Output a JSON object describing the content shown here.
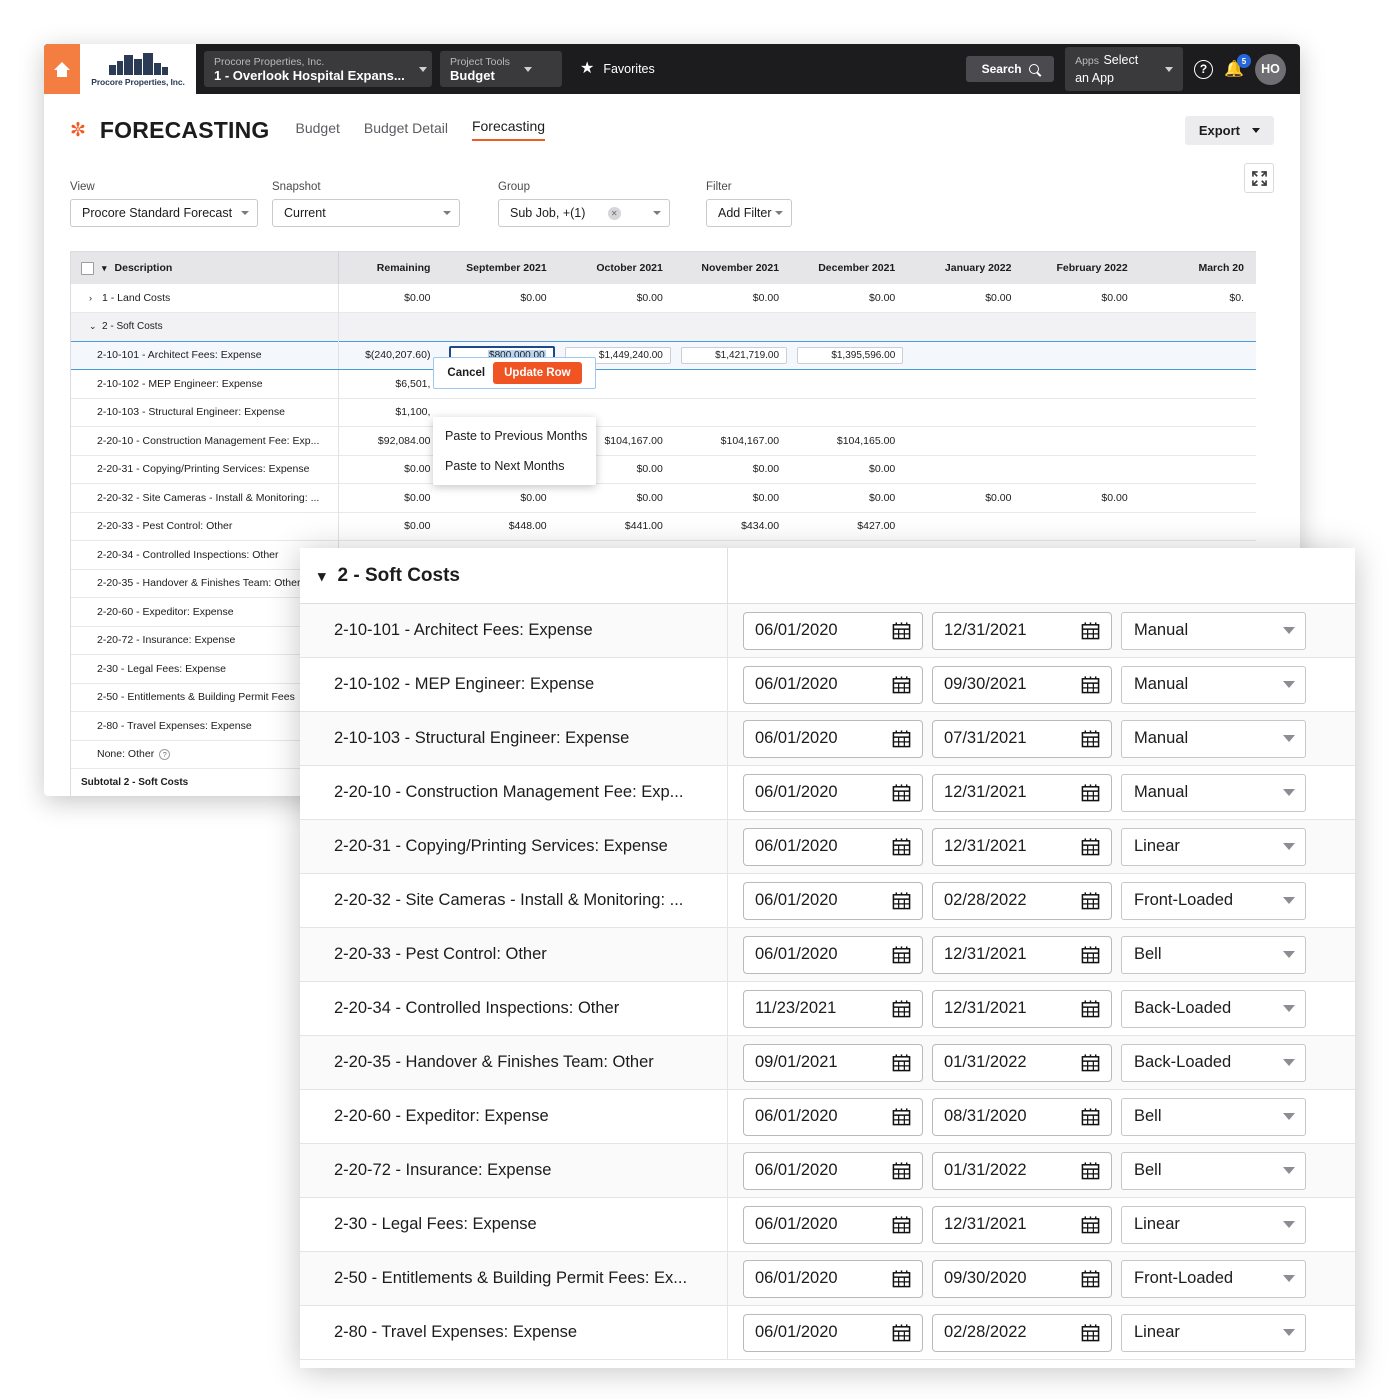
{
  "topnav": {
    "home_icon": "home-icon",
    "logo_name": "Procore Properties, Inc.",
    "company_select": {
      "label": "Procore Properties, Inc.",
      "value": "1 - Overlook Hospital Expans..."
    },
    "tools_select": {
      "label": "Project Tools",
      "value": "Budget"
    },
    "favorites": "Favorites",
    "search": "Search",
    "apps_select": {
      "label": "Apps",
      "value": "Select an App"
    },
    "help_icon": "?",
    "notification_count": "5",
    "avatar_initials": "HO"
  },
  "page": {
    "title": "FORECASTING",
    "tabs": [
      {
        "label": "Budget",
        "active": false
      },
      {
        "label": "Budget Detail",
        "active": false
      },
      {
        "label": "Forecasting",
        "active": true
      }
    ],
    "export_label": "Export"
  },
  "filters": [
    {
      "name": "view",
      "label": "View",
      "value": "Procore Standard Forecast"
    },
    {
      "name": "snapshot",
      "label": "Snapshot",
      "value": "Current"
    },
    {
      "name": "group",
      "label": "Group",
      "value": "Sub Job, +(1)"
    },
    {
      "name": "filter",
      "label": "Filter",
      "value": "Add Filter"
    }
  ],
  "table": {
    "columns": [
      "Description",
      "Remaining",
      "September 2021",
      "October 2021",
      "November 2021",
      "December 2021",
      "January 2022",
      "February 2022",
      "March 20"
    ],
    "rows": [
      {
        "kind": "group",
        "twisty": "›",
        "desc": "1 - Land Costs",
        "vals": [
          "$0.00",
          "$0.00",
          "$0.00",
          "$0.00",
          "$0.00",
          "$0.00",
          "$0.00",
          "$0."
        ]
      },
      {
        "kind": "group",
        "twisty": "⌄",
        "desc": "2 - Soft Costs",
        "vals": [
          "",
          "",
          "",
          "",
          "",
          "",
          "",
          ""
        ]
      },
      {
        "kind": "selected",
        "desc": "2-10-101 - Architect Fees: Expense",
        "remaining": "$(240,207.60)",
        "editable": [
          "$800,000.00",
          "$1,449,240.00",
          "$1,421,719.00",
          "$1,395,596.00"
        ],
        "vals": [
          "",
          "",
          "",
          ""
        ]
      },
      {
        "kind": "item",
        "desc": "2-10-102 - MEP Engineer: Expense",
        "vals": [
          "$6,501,",
          "",
          "",
          "",
          "",
          "",
          "",
          ""
        ]
      },
      {
        "kind": "item",
        "desc": "2-10-103 - Structural Engineer: Expense",
        "vals": [
          "$1,100,",
          "",
          "",
          "",
          "",
          "",
          "",
          ""
        ]
      },
      {
        "kind": "item",
        "desc": "2-20-10 - Construction Management Fee: Exp...",
        "vals": [
          "$92,084.00",
          "$104,167.00",
          "$104,167.00",
          "$104,167.00",
          "$104,165.00",
          "",
          "",
          ""
        ]
      },
      {
        "kind": "item",
        "desc": "2-20-31 - Copying/Printing Services: Expense",
        "vals": [
          "$0.00",
          "$0.00",
          "$0.00",
          "$0.00",
          "$0.00",
          "",
          "",
          ""
        ]
      },
      {
        "kind": "item",
        "desc": "2-20-32 - Site Cameras - Install & Monitoring: ...",
        "vals": [
          "$0.00",
          "$0.00",
          "$0.00",
          "$0.00",
          "$0.00",
          "$0.00",
          "$0.00",
          ""
        ]
      },
      {
        "kind": "item",
        "desc": "2-20-33 - Pest Control: Other",
        "vals": [
          "$0.00",
          "$448.00",
          "$441.00",
          "$434.00",
          "$427.00",
          "",
          "",
          ""
        ]
      },
      {
        "kind": "item",
        "desc": "2-20-34 - Controlled Inspections: Other",
        "vals": [
          "",
          "",
          "",
          "",
          "",
          "",
          "",
          ""
        ]
      },
      {
        "kind": "item",
        "desc": "2-20-35 - Handover & Finishes Team: Other",
        "vals": [
          "",
          "",
          "",
          "",
          "",
          "",
          "",
          ""
        ]
      },
      {
        "kind": "item",
        "desc": "2-20-60 - Expeditor: Expense",
        "vals": [
          "",
          "",
          "",
          "",
          "",
          "",
          "",
          ""
        ]
      },
      {
        "kind": "item",
        "desc": "2-20-72 - Insurance: Expense",
        "vals": [
          "",
          "",
          "",
          "",
          "",
          "",
          "",
          ""
        ]
      },
      {
        "kind": "item",
        "desc": "2-30 - Legal Fees: Expense",
        "vals": [
          "",
          "",
          "",
          "",
          "",
          "",
          "",
          ""
        ]
      },
      {
        "kind": "item",
        "desc": "2-50 - Entitlements & Building Permit Fees",
        "vals": [
          "",
          "",
          "",
          "",
          "",
          "",
          "",
          ""
        ]
      },
      {
        "kind": "item",
        "desc": "2-80 - Travel Expenses: Expense",
        "vals": [
          "",
          "",
          "",
          "",
          "",
          "",
          "",
          ""
        ]
      },
      {
        "kind": "item",
        "desc": "None: Other",
        "help": true,
        "vals": [
          "",
          "",
          "",
          "",
          "",
          "",
          "",
          ""
        ]
      },
      {
        "kind": "subtotal",
        "desc": "Subtotal 2 - Soft Costs",
        "vals": [
          "",
          "",
          "",
          "",
          "",
          "",
          "",
          ""
        ]
      }
    ]
  },
  "update_popover": {
    "cancel": "Cancel",
    "update": "Update Row"
  },
  "context_menu": {
    "items": [
      "Paste to Previous Months",
      "Paste to Next Months"
    ]
  },
  "collapse_icon": "«",
  "forecast_panel": {
    "group_title": "2 - Soft Costs",
    "rows": [
      {
        "name": "2-10-101 - Architect Fees: Expense",
        "start": "06/01/2020",
        "end": "12/31/2021",
        "curve": "Manual"
      },
      {
        "name": "2-10-102 - MEP Engineer: Expense",
        "start": "06/01/2020",
        "end": "09/30/2021",
        "curve": "Manual"
      },
      {
        "name": "2-10-103 - Structural Engineer: Expense",
        "start": "06/01/2020",
        "end": "07/31/2021",
        "curve": "Manual"
      },
      {
        "name": "2-20-10 - Construction Management Fee: Exp...",
        "start": "06/01/2020",
        "end": "12/31/2021",
        "curve": "Manual"
      },
      {
        "name": "2-20-31 - Copying/Printing Services: Expense",
        "start": "06/01/2020",
        "end": "12/31/2021",
        "curve": "Linear"
      },
      {
        "name": "2-20-32 - Site Cameras - Install & Monitoring: ...",
        "start": "06/01/2020",
        "end": "02/28/2022",
        "curve": "Front-Loaded"
      },
      {
        "name": "2-20-33 - Pest Control: Other",
        "start": "06/01/2020",
        "end": "12/31/2021",
        "curve": "Bell"
      },
      {
        "name": "2-20-34 - Controlled Inspections: Other",
        "start": "11/23/2021",
        "end": "12/31/2021",
        "curve": "Back-Loaded"
      },
      {
        "name": "2-20-35 - Handover & Finishes Team: Other",
        "start": "09/01/2021",
        "end": "01/31/2022",
        "curve": "Back-Loaded"
      },
      {
        "name": "2-20-60 - Expeditor: Expense",
        "start": "06/01/2020",
        "end": "08/31/2020",
        "curve": "Bell"
      },
      {
        "name": "2-20-72 - Insurance: Expense",
        "start": "06/01/2020",
        "end": "01/31/2022",
        "curve": "Bell"
      },
      {
        "name": "2-30 - Legal Fees: Expense",
        "start": "06/01/2020",
        "end": "12/31/2021",
        "curve": "Linear"
      },
      {
        "name": "2-50 - Entitlements & Building Permit Fees: Ex...",
        "start": "06/01/2020",
        "end": "09/30/2020",
        "curve": "Front-Loaded"
      },
      {
        "name": "2-80 - Travel Expenses: Expense",
        "start": "06/01/2020",
        "end": "02/28/2022",
        "curve": "Linear"
      }
    ]
  },
  "colors": {
    "brand_orange": "#f15a22",
    "nav_dark": "#1c1c1e",
    "select_blue": "#4a9ae0"
  }
}
